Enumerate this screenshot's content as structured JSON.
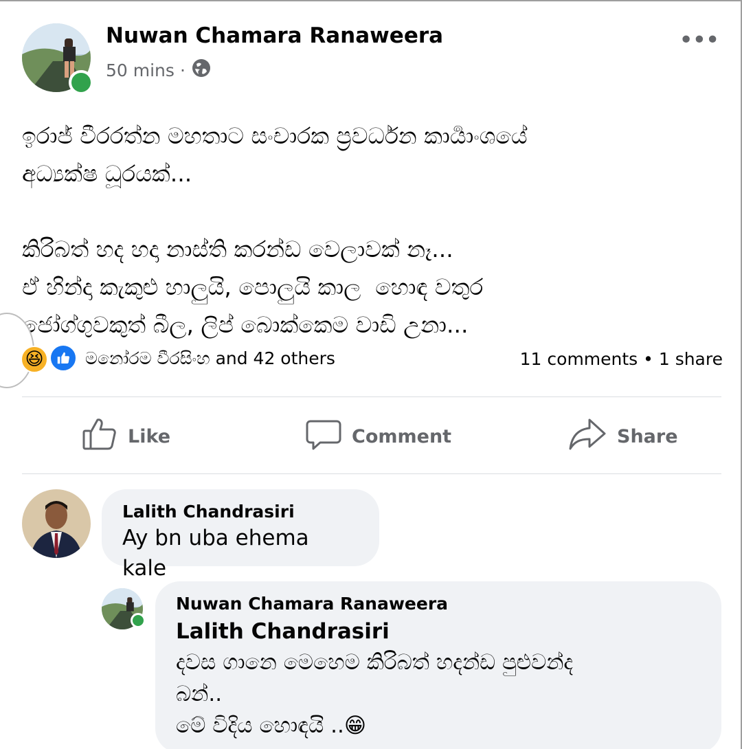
{
  "post": {
    "author": "Nuwan Chamara Ranaweera",
    "time": "50 mins",
    "separator": "·",
    "privacy_icon": "globe-icon",
    "more_icon": "more-options-icon",
    "more_label": "•••",
    "text": "ඉරාජ් වීරරත්න මහතාට සංචාරක ප්‍රවර්ධන කාර්‍යාංශයේ\nඅධ්‍යක්ෂ ධූරයක්...\n\nකිරිබත් හද හදා නාස්ති කරන්ඩ වෙලාවක් නෑ...\nඒ හින්දා කැකුළු හාලුයි, පොලුයි කාල  හොඳ වතුර\nජෝග්ගුවකුත් බීල, ලිප් බොක්කෙම වාඩි උනා..."
  },
  "reactions": {
    "types": [
      "haha",
      "like"
    ],
    "names": "මනෝරම වීරසිංහ and 42 others",
    "counts": "11 comments • 1 share"
  },
  "actions": {
    "like": "Like",
    "comment": "Comment",
    "share": "Share"
  },
  "comments": [
    {
      "author": "Lalith Chandrasiri",
      "text": "Ay bn uba ehema kale"
    }
  ],
  "reply": {
    "author": "Nuwan Chamara Ranaweera",
    "mention": "Lalith Chandrasiri",
    "text": "දවස ගානෙ මෙහෙම කිරිබත් හදන්ඩ පුළුවන්ද\nබන්..\nමේ විදිය හොඳයි ..😁"
  },
  "colors": {
    "accent": "#1877f2",
    "online": "#31a24c",
    "secondary_text": "#65676b",
    "bubble": "#f0f2f5"
  }
}
